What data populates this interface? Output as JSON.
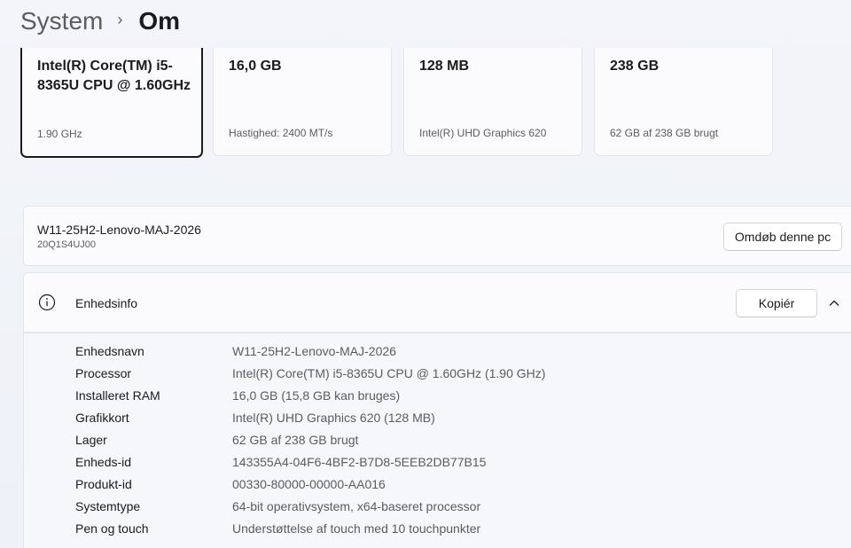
{
  "header": {
    "parent": "System",
    "separator": "›",
    "current": "Om"
  },
  "cards": [
    {
      "value": "Intel(R) Core(TM) i5-8365U CPU @ 1.60GHz",
      "sub": "1.90 GHz",
      "selected": true
    },
    {
      "value": "16,0 GB",
      "sub": "Hastighed: 2400 MT/s"
    },
    {
      "value": "128 MB",
      "sub": "Intel(R) UHD Graphics 620"
    },
    {
      "value": "238 GB",
      "sub": "62 GB af 238 GB brugt"
    }
  ],
  "device": {
    "name": "W11-25H2-Lenovo-MAJ-2026",
    "model": "20Q1S4UJ00",
    "rename_label": "Omdøb denne pc"
  },
  "info": {
    "title": "Enhedsinfo",
    "copy_label": "Kopiér",
    "rows": [
      {
        "key": "Enhedsnavn",
        "value": "W11-25H2-Lenovo-MAJ-2026"
      },
      {
        "key": "Processor",
        "value": "Intel(R) Core(TM) i5-8365U CPU @ 1.60GHz (1.90 GHz)"
      },
      {
        "key": "Installeret RAM",
        "value": "16,0 GB (15,8 GB kan bruges)"
      },
      {
        "key": "Grafikkort",
        "value": "Intel(R) UHD Graphics 620 (128 MB)"
      },
      {
        "key": "Lager",
        "value": "62 GB af 238 GB brugt"
      },
      {
        "key": "Enheds-id",
        "value": "143355A4-04F6-4BF2-B7D8-5EEB2DB77B15"
      },
      {
        "key": "Produkt-id",
        "value": "00330-80000-00000-AA016"
      },
      {
        "key": "Systemtype",
        "value": "64-bit operativsystem, x64-baseret processor"
      },
      {
        "key": "Pen og touch",
        "value": "Understøttelse af touch med 10 touchpunkter"
      }
    ]
  },
  "icons": {
    "info": "info-circle-icon",
    "chevron": "chevron-up-icon"
  }
}
